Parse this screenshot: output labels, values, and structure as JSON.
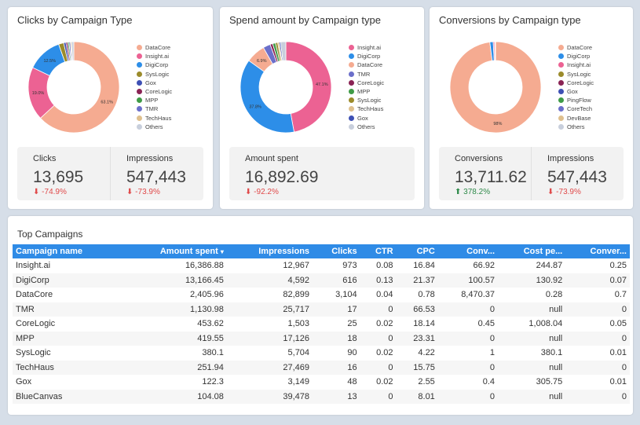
{
  "colors": {
    "DataCore": "#f5ab91",
    "Insight.ai": "#ec6293",
    "DigiCorp": "#2d8ee8",
    "SysLogic": "#9b8b2b",
    "Gox": "#3e50b4",
    "CoreLogic": "#8a2354",
    "MPP": "#3f9b47",
    "TMR": "#6b6fca",
    "TechHaus": "#dfc08e",
    "Others": "#c8cfdc",
    "PingFlow": "#3f9b47",
    "CoreTech": "#6b6fca",
    "DevBase": "#dfc08e"
  },
  "charts": [
    {
      "title": "Clicks by Campaign Type",
      "chart_data": {
        "type": "pie",
        "labels": [
          "DataCore",
          "Insight.ai",
          "DigiCorp",
          "SysLogic",
          "Gox",
          "CoreLogic",
          "MPP",
          "TMR",
          "TechHaus",
          "Others"
        ],
        "values": [
          63.1,
          19.0,
          12.5,
          1.8,
          0.8,
          0.6,
          0.5,
          0.5,
          0.4,
          0.8
        ],
        "data_labels": [
          "63.1%",
          "19.0%",
          "12.5%"
        ]
      },
      "kpis": [
        {
          "label": "Clicks",
          "value": "13,695",
          "delta": "-74.9%",
          "dir": "down"
        },
        {
          "label": "Impressions",
          "value": "547,443",
          "delta": "-73.9%",
          "dir": "down"
        }
      ]
    },
    {
      "title": "Spend amount by Campaign type",
      "chart_data": {
        "type": "pie",
        "labels": [
          "Insight.ai",
          "DigiCorp",
          "DataCore",
          "TMR",
          "CoreLogic",
          "MPP",
          "SysLogic",
          "TechHaus",
          "Gox",
          "Others"
        ],
        "values": [
          47.1,
          37.8,
          6.9,
          2.6,
          0.9,
          1.0,
          0.8,
          0.6,
          0.5,
          1.8
        ],
        "data_labels": [
          "47.1%",
          "37.8%",
          "6.9%"
        ]
      },
      "kpis": [
        {
          "label": "Amount spent",
          "value": "16,892.69",
          "delta": "-92.2%",
          "dir": "down"
        }
      ]
    },
    {
      "title": "Conversions by Campaign type",
      "chart_data": {
        "type": "pie",
        "labels": [
          "DataCore",
          "DigiCorp",
          "Insight.ai",
          "SysLogic",
          "CoreLogic",
          "Gox",
          "PingFlow",
          "CoreTech",
          "DevBase",
          "Others"
        ],
        "values": [
          98,
          1.2,
          0.5,
          0.05,
          0.05,
          0.05,
          0.04,
          0.04,
          0.03,
          0.04
        ],
        "data_labels": [
          "98%"
        ]
      },
      "kpis": [
        {
          "label": "Conversions",
          "value": "13,711.62",
          "delta": "378.2%",
          "dir": "up"
        },
        {
          "label": "Impressions",
          "value": "547,443",
          "delta": "-73.9%",
          "dir": "down"
        }
      ]
    }
  ],
  "table": {
    "title": "Top Campaigns",
    "sort_indicator": "▾",
    "columns": [
      "Campaign name",
      "Amount spent",
      "Impressions",
      "Clicks",
      "CTR",
      "CPC",
      "Conv...",
      "Cost pe...",
      "Conver..."
    ],
    "rows": [
      [
        "Insight.ai",
        "16,386.88",
        "12,967",
        "973",
        "0.08",
        "16.84",
        "66.92",
        "244.87",
        "0.25"
      ],
      [
        "DigiCorp",
        "13,166.45",
        "4,592",
        "616",
        "0.13",
        "21.37",
        "100.57",
        "130.92",
        "0.07"
      ],
      [
        "DataCore",
        "2,405.96",
        "82,899",
        "3,104",
        "0.04",
        "0.78",
        "8,470.37",
        "0.28",
        "0.7"
      ],
      [
        "TMR",
        "1,130.98",
        "25,717",
        "17",
        "0",
        "66.53",
        "0",
        "null",
        "0"
      ],
      [
        "CoreLogic",
        "453.62",
        "1,503",
        "25",
        "0.02",
        "18.14",
        "0.45",
        "1,008.04",
        "0.05"
      ],
      [
        "MPP",
        "419.55",
        "17,126",
        "18",
        "0",
        "23.31",
        "0",
        "null",
        "0"
      ],
      [
        "SysLogic",
        "380.1",
        "5,704",
        "90",
        "0.02",
        "4.22",
        "1",
        "380.1",
        "0.01"
      ],
      [
        "TechHaus",
        "251.94",
        "27,469",
        "16",
        "0",
        "15.75",
        "0",
        "null",
        "0"
      ],
      [
        "Gox",
        "122.3",
        "3,149",
        "48",
        "0.02",
        "2.55",
        "0.4",
        "305.75",
        "0.01"
      ],
      [
        "BlueCanvas",
        "104.08",
        "39,478",
        "13",
        "0",
        "8.01",
        "0",
        "null",
        "0"
      ]
    ]
  }
}
